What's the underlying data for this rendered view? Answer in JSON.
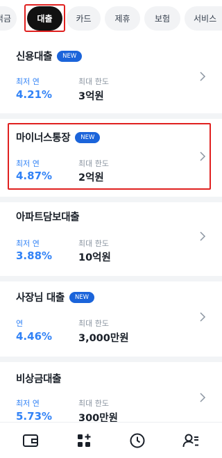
{
  "tabs": [
    {
      "label": "예적금",
      "visible_label": "적금"
    },
    {
      "label": "대출"
    },
    {
      "label": "카드"
    },
    {
      "label": "제휴"
    },
    {
      "label": "보험"
    },
    {
      "label": "서비스"
    }
  ],
  "active_tab": "대출",
  "products": [
    {
      "name": "신용대출",
      "badge": "NEW",
      "rate_label": "최저 연",
      "rate": "4.21%",
      "limit_label": "최대 한도",
      "limit": "3억원"
    },
    {
      "name": "마이너스통장",
      "badge": "NEW",
      "rate_label": "최저 연",
      "rate": "4.87%",
      "limit_label": "최대 한도",
      "limit": "2억원"
    },
    {
      "name": "아파트담보대출",
      "badge": "",
      "rate_label": "최저 연",
      "rate": "3.88%",
      "limit_label": "최대 한도",
      "limit": "10억원"
    },
    {
      "name": "사장님 대출",
      "badge": "NEW",
      "rate_label": "연",
      "rate": "4.46%",
      "limit_label": "최대 한도",
      "limit": "3,000만원"
    },
    {
      "name": "비상금대출",
      "badge": "",
      "rate_label": "최저 연",
      "rate": "5.73%",
      "limit_label": "최대 한도",
      "limit": "300만원"
    }
  ],
  "bottom_nav": [
    {
      "icon": "wallet-icon"
    },
    {
      "icon": "apps-plus-icon"
    },
    {
      "icon": "clock-icon"
    },
    {
      "icon": "profile-menu-icon"
    }
  ],
  "colors": {
    "accent": "#3182f6",
    "badge": "#1b64da",
    "highlight": "#e0201f"
  }
}
